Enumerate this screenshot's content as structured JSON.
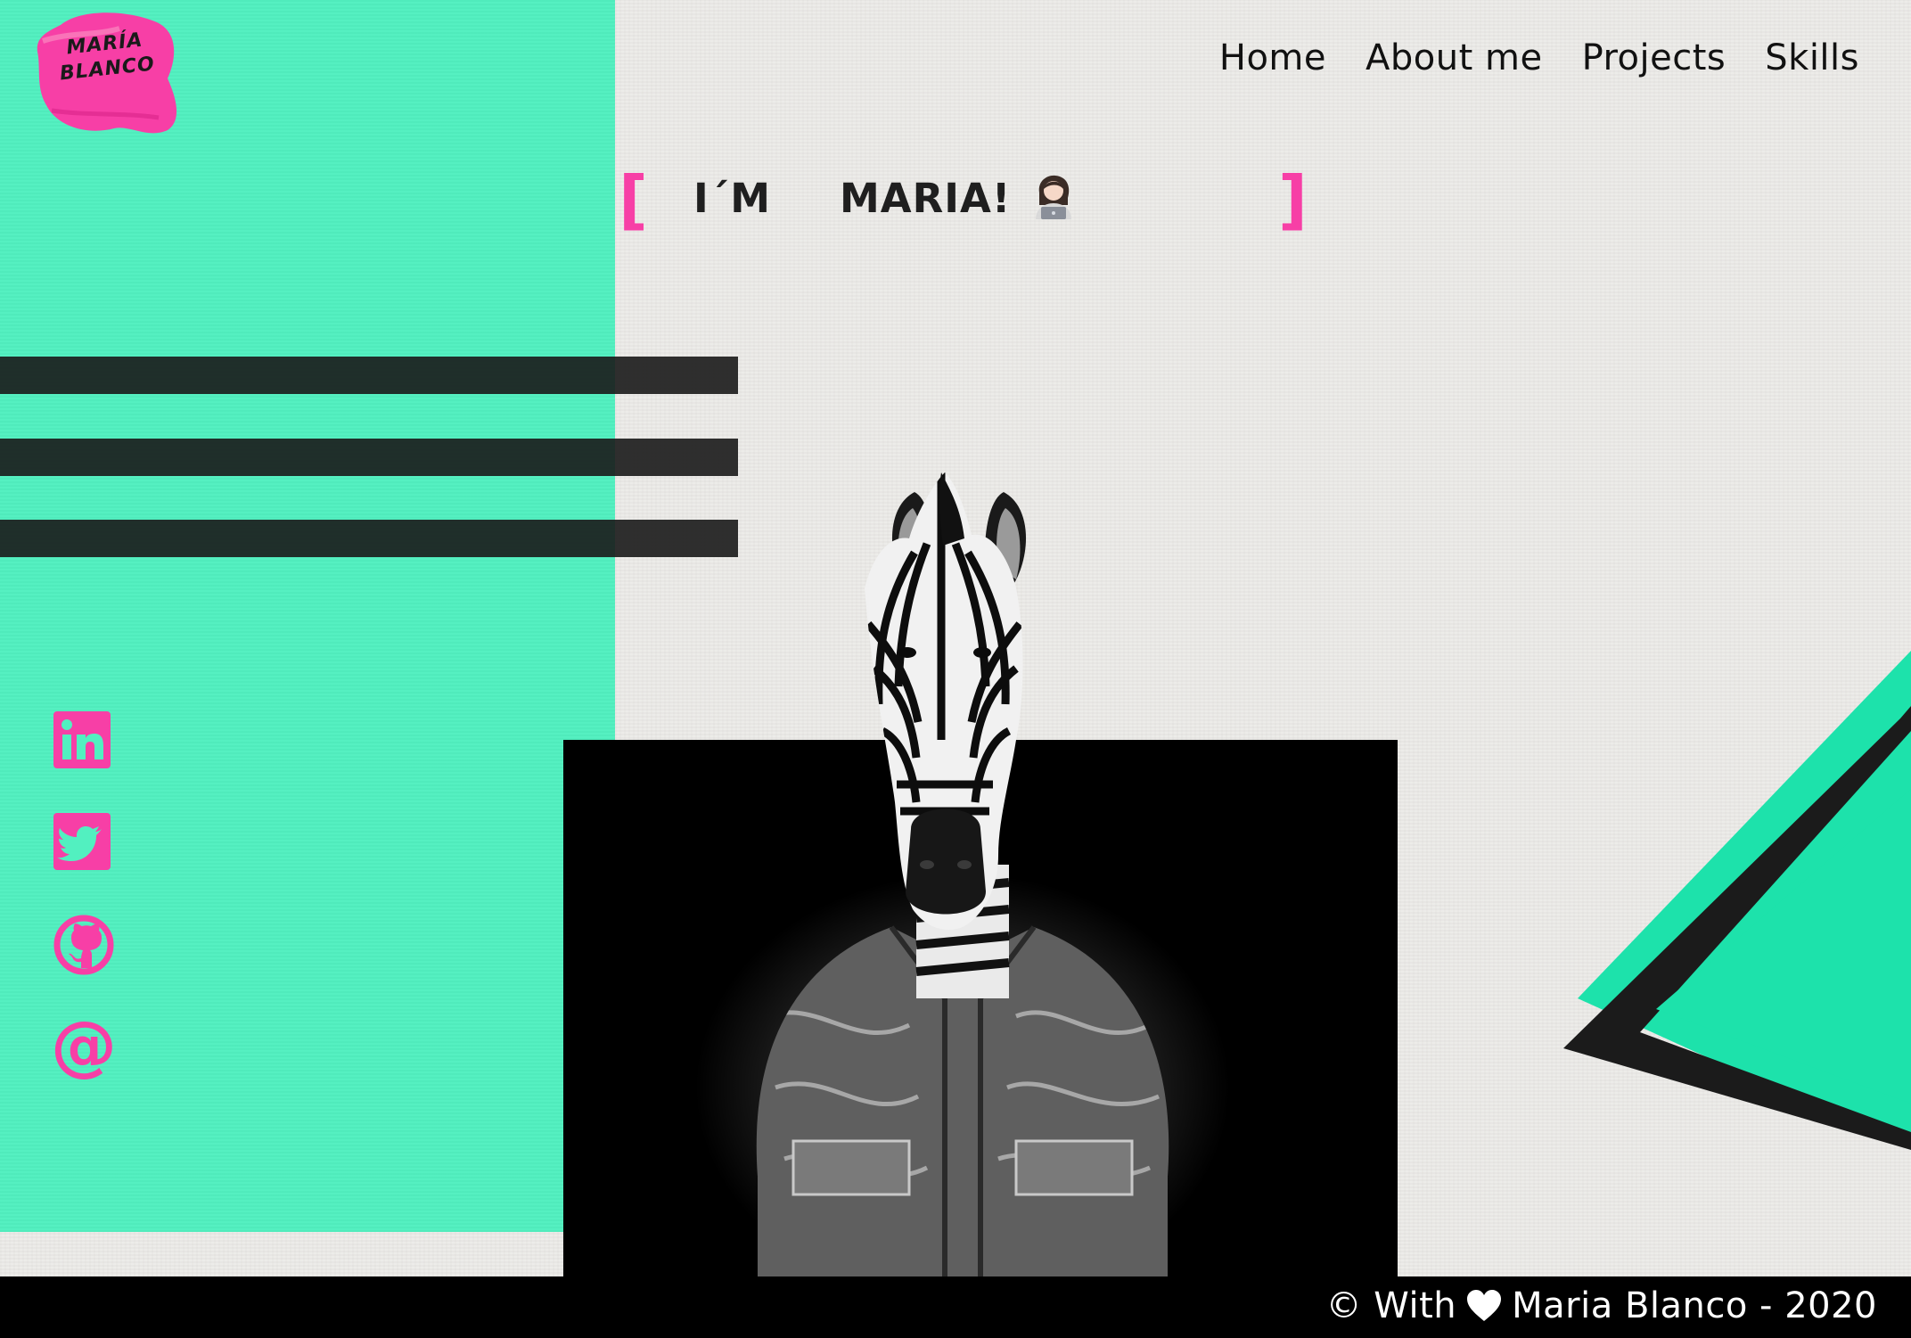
{
  "brand": {
    "logo_line1": "MARÍA",
    "logo_line2": "BLANCO",
    "accent": "#f73fa6",
    "mint": "#52f0c0"
  },
  "nav": {
    "items": [
      {
        "label": "Home"
      },
      {
        "label": "About me"
      },
      {
        "label": "Projects"
      },
      {
        "label": "Skills"
      }
    ]
  },
  "hero": {
    "word1": "I´M",
    "word2": "MARIA!",
    "bracket_open": "[",
    "bracket_close": "]",
    "emoji": "woman-technologist-icon"
  },
  "social": [
    {
      "name": "linkedin-icon"
    },
    {
      "name": "twitter-icon"
    },
    {
      "name": "github-icon"
    },
    {
      "name": "at-email-icon"
    }
  ],
  "footer": {
    "prefix": "© With",
    "suffix": "Maria Blanco - 2020",
    "icon": "heart-icon"
  }
}
